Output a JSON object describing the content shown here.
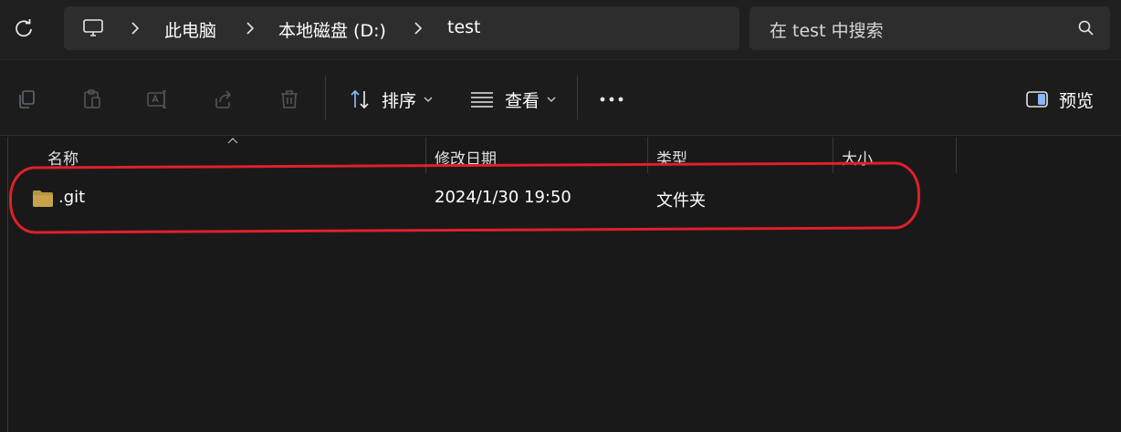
{
  "address": {
    "breadcrumbs": [
      "此电脑",
      "本地磁盘 (D:)",
      "test"
    ]
  },
  "search": {
    "placeholder": "在 test 中搜索"
  },
  "toolbar": {
    "sort_label": "排序",
    "view_label": "查看",
    "preview_label": "预览",
    "icons": [
      "copy-icon",
      "paste-icon",
      "rename-icon",
      "share-icon",
      "delete-icon"
    ]
  },
  "columns": {
    "name": "名称",
    "modified": "修改日期",
    "type": "类型",
    "size": "大小"
  },
  "files": [
    {
      "name": ".git",
      "modified": "2024/1/30 19:50",
      "type": "文件夹",
      "size": ""
    }
  ],
  "colors": {
    "folder": "#c7a24a",
    "highlight": "#e0202a",
    "accent": "#8ab4f8"
  }
}
